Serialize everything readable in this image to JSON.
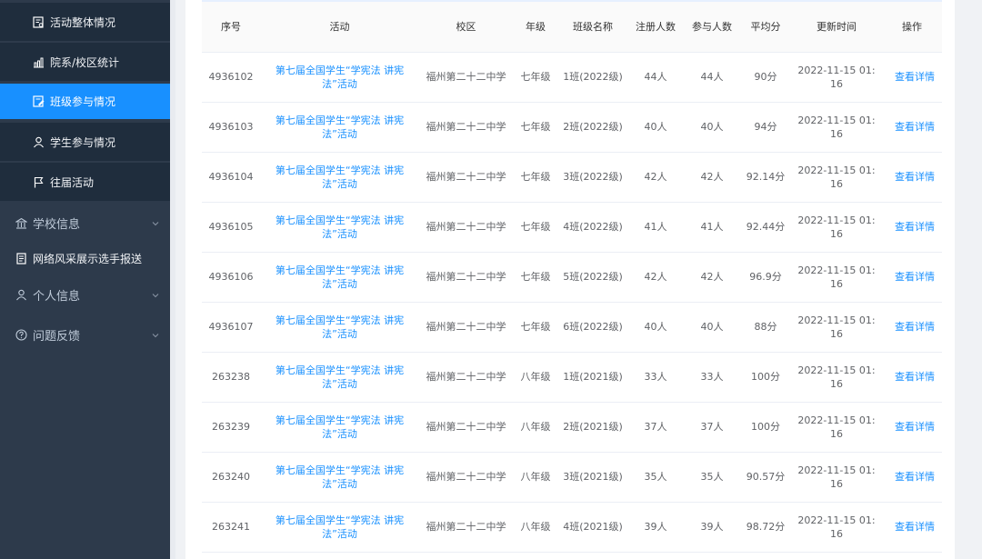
{
  "sidebar": {
    "sub_items": [
      {
        "label": "活动整体情况",
        "icon": "report-icon"
      },
      {
        "label": "院系/校区统计",
        "icon": "bar-chart-icon"
      },
      {
        "label": "班级参与情况",
        "icon": "class-edit-icon"
      },
      {
        "label": "学生参与情况",
        "icon": "user-icon"
      },
      {
        "label": "往届活动",
        "icon": "flag-icon"
      }
    ],
    "top_items": [
      {
        "label": "学校信息",
        "icon": "school-icon"
      },
      {
        "label": "网络风采展示选手报送",
        "icon": "document-icon"
      },
      {
        "label": "个人信息",
        "icon": "user-icon"
      },
      {
        "label": "问题反馈",
        "icon": "question-icon"
      }
    ]
  },
  "table": {
    "headers": {
      "id": "序号",
      "activity": "活动",
      "campus": "校区",
      "grade": "年级",
      "class_name": "班级名称",
      "registered": "注册人数",
      "participants": "参与人数",
      "avg_score": "平均分",
      "updated": "更新时间",
      "action": "操作"
    },
    "rows": [
      {
        "id": "4936102",
        "activity": "第七届全国学生“学宪法 讲宪法”活动",
        "campus": "福州第二十二中学",
        "grade": "七年级",
        "class_name": "1班(2022级)",
        "registered": "44人",
        "participants": "44人",
        "avg_score": "90分",
        "updated": "2022-11-15 01:16",
        "action": "查看详情"
      },
      {
        "id": "4936103",
        "activity": "第七届全国学生“学宪法 讲宪法”活动",
        "campus": "福州第二十二中学",
        "grade": "七年级",
        "class_name": "2班(2022级)",
        "registered": "40人",
        "participants": "40人",
        "avg_score": "94分",
        "updated": "2022-11-15 01:16",
        "action": "查看详情"
      },
      {
        "id": "4936104",
        "activity": "第七届全国学生“学宪法 讲宪法”活动",
        "campus": "福州第二十二中学",
        "grade": "七年级",
        "class_name": "3班(2022级)",
        "registered": "42人",
        "participants": "42人",
        "avg_score": "92.14分",
        "updated": "2022-11-15 01:16",
        "action": "查看详情"
      },
      {
        "id": "4936105",
        "activity": "第七届全国学生“学宪法 讲宪法”活动",
        "campus": "福州第二十二中学",
        "grade": "七年级",
        "class_name": "4班(2022级)",
        "registered": "41人",
        "participants": "41人",
        "avg_score": "92.44分",
        "updated": "2022-11-15 01:16",
        "action": "查看详情"
      },
      {
        "id": "4936106",
        "activity": "第七届全国学生“学宪法 讲宪法”活动",
        "campus": "福州第二十二中学",
        "grade": "七年级",
        "class_name": "5班(2022级)",
        "registered": "42人",
        "participants": "42人",
        "avg_score": "96.9分",
        "updated": "2022-11-15 01:16",
        "action": "查看详情"
      },
      {
        "id": "4936107",
        "activity": "第七届全国学生“学宪法 讲宪法”活动",
        "campus": "福州第二十二中学",
        "grade": "七年级",
        "class_name": "6班(2022级)",
        "registered": "40人",
        "participants": "40人",
        "avg_score": "88分",
        "updated": "2022-11-15 01:16",
        "action": "查看详情"
      },
      {
        "id": "263238",
        "activity": "第七届全国学生“学宪法 讲宪法”活动",
        "campus": "福州第二十二中学",
        "grade": "八年级",
        "class_name": "1班(2021级)",
        "registered": "33人",
        "participants": "33人",
        "avg_score": "100分",
        "updated": "2022-11-15 01:16",
        "action": "查看详情"
      },
      {
        "id": "263239",
        "activity": "第七届全国学生“学宪法 讲宪法”活动",
        "campus": "福州第二十二中学",
        "grade": "八年级",
        "class_name": "2班(2021级)",
        "registered": "37人",
        "participants": "37人",
        "avg_score": "100分",
        "updated": "2022-11-15 01:16",
        "action": "查看详情"
      },
      {
        "id": "263240",
        "activity": "第七届全国学生“学宪法 讲宪法”活动",
        "campus": "福州第二十二中学",
        "grade": "八年级",
        "class_name": "3班(2021级)",
        "registered": "35人",
        "participants": "35人",
        "avg_score": "90.57分",
        "updated": "2022-11-15 01:16",
        "action": "查看详情"
      },
      {
        "id": "263241",
        "activity": "第七届全国学生“学宪法 讲宪法”活动",
        "campus": "福州第二十二中学",
        "grade": "八年级",
        "class_name": "4班(2021级)",
        "registered": "39人",
        "participants": "39人",
        "avg_score": "98.72分",
        "updated": "2022-11-15 01:16",
        "action": "查看详情"
      }
    ]
  }
}
